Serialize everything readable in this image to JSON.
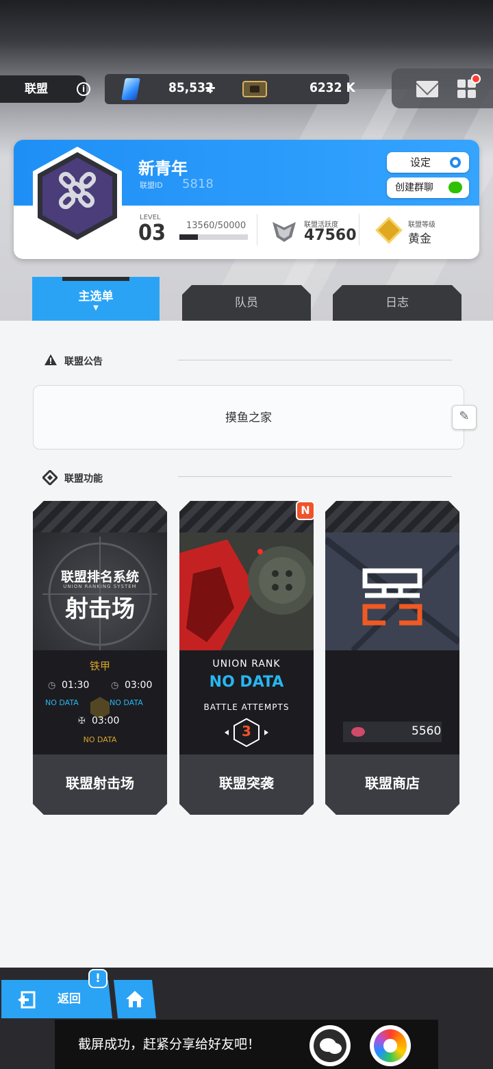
{
  "header": {
    "union_label": "联盟",
    "info_icon": "i",
    "crystals": "85,532",
    "crystals_plus": "+",
    "credits": "6232 K"
  },
  "profile": {
    "name": "新青年",
    "id_label": "联盟ID",
    "id_value": "5818",
    "settings_label": "设定",
    "create_chat_label": "创建群聊",
    "level_label": "LEVEL",
    "level_value": "03",
    "exp_text": "13560/50000",
    "exp_progress": 0.27,
    "activity_label": "联盟活跃度",
    "activity_value": "47560",
    "rank_label": "联盟等级",
    "rank_value": "黄金"
  },
  "tabs": {
    "main": "主选单",
    "main_arrow": "▼",
    "members": "队员",
    "log": "日志"
  },
  "notice": {
    "title": "联盟公告",
    "content": "摸鱼之家"
  },
  "functions": {
    "title": "联盟功能",
    "cards": [
      {
        "label": "联盟射击场",
        "poster_title": "联盟排名系统",
        "poster_sub": "UNION RANKING SYSTEM",
        "poster_main": "射击场",
        "tier": "铁甲",
        "time1": "01:30",
        "time2": "03:00",
        "nodata1": "NO DATA",
        "nodata2": "NO DATA",
        "time3": "03:00",
        "nodata3": "NO DATA"
      },
      {
        "label": "联盟突袭",
        "badge": "N",
        "rank_title": "UNION RANK",
        "rank_value": "NO DATA",
        "attempts_label": "BATTLE ATTEMPTS",
        "attempts_value": "3"
      },
      {
        "label": "联盟商店",
        "currency_value": "5560"
      }
    ]
  },
  "bottom": {
    "back_label": "返回",
    "alert": "!",
    "toast_text": "截屏成功，赶紧分享给好友吧！"
  }
}
